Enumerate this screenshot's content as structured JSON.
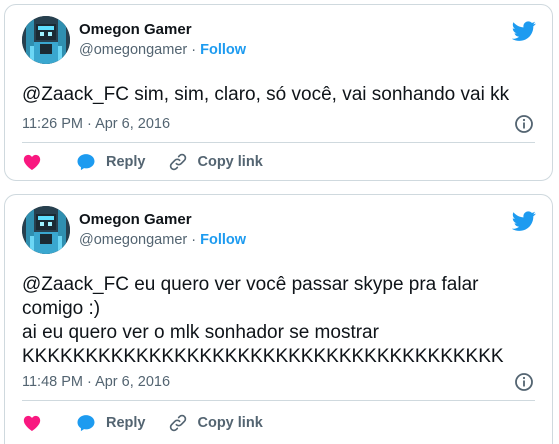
{
  "tweets": [
    {
      "author_name": "Omegon Gamer",
      "author_handle": "@omegongamer",
      "separator": "·",
      "follow_label": "Follow",
      "text": "@Zaack_FC sim, sim, claro, só você, vai sonhando vai kk",
      "timestamp": "11:26 PM · Apr 6, 2016",
      "reply_label": "Reply",
      "copy_link_label": "Copy link"
    },
    {
      "author_name": "Omegon Gamer",
      "author_handle": "@omegongamer",
      "separator": "·",
      "follow_label": "Follow",
      "text": "@Zaack_FC eu quero ver você passar skype pra falar\ncomigo :)\nai eu quero ver o mlk sonhador se mostrar\nKKKKKKKKKKKKKKKKKKKKKKKKKKKKKKKKKKKKKK",
      "timestamp": "11:48 PM · Apr 6, 2016",
      "reply_label": "Reply",
      "copy_link_label": "Copy link"
    }
  ],
  "colors": {
    "brand": "#1d9bf0",
    "like": "#f91880",
    "text_primary": "#0f1419",
    "text_secondary": "#536471",
    "border": "#cfd9de"
  },
  "icons": {
    "platform": "twitter-bird-icon",
    "like": "heart-icon",
    "reply": "speech-bubble-icon",
    "copy_link": "link-icon",
    "info": "info-icon"
  }
}
